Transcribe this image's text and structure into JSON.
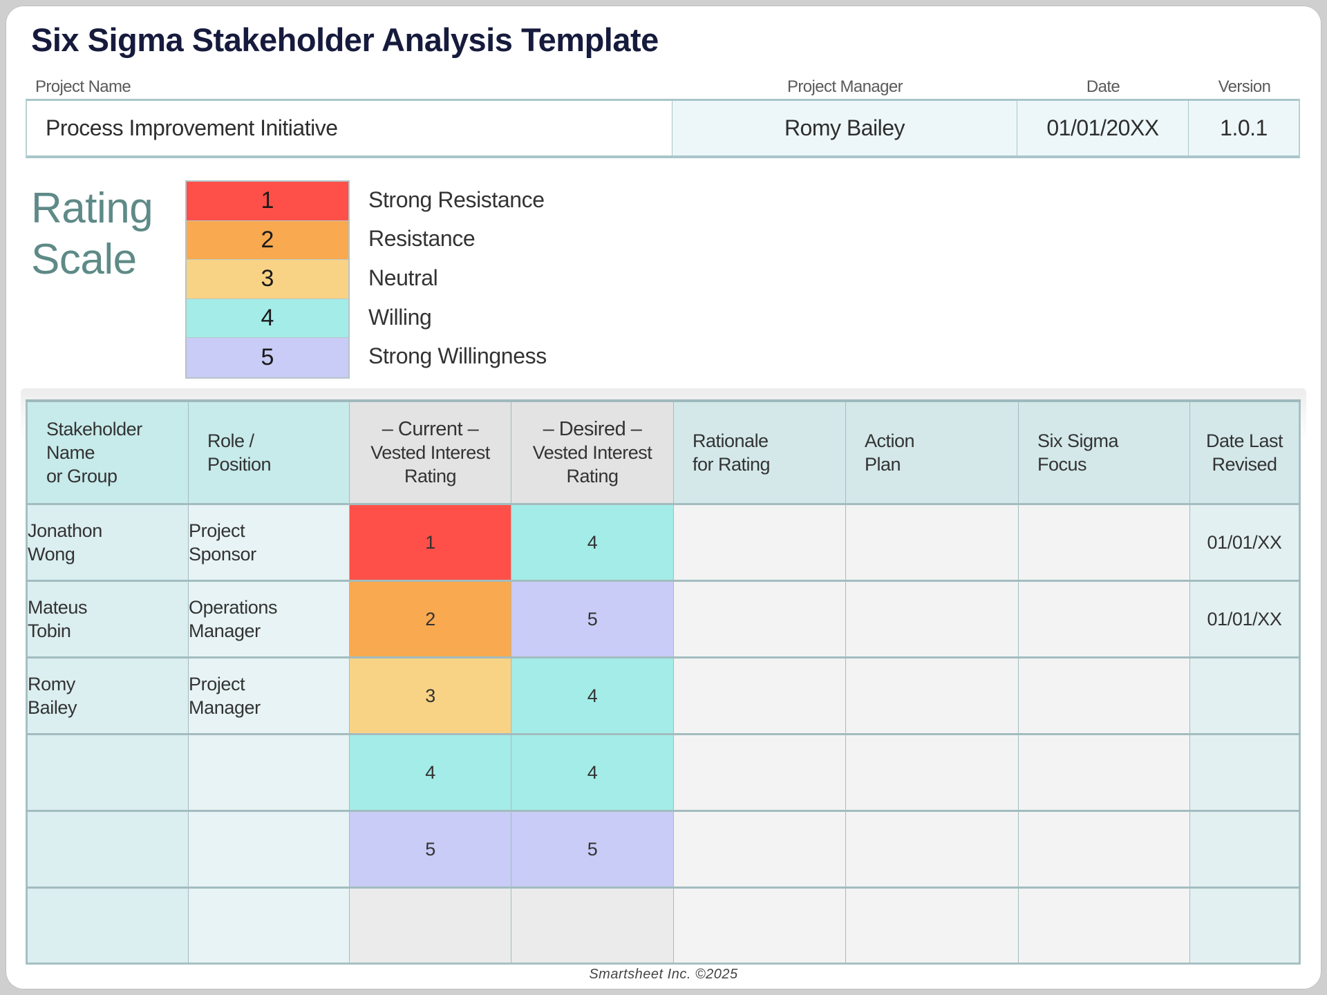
{
  "title": "Six Sigma Stakeholder Analysis Template",
  "project_info": {
    "labels": {
      "project_name": "Project Name",
      "project_manager": "Project Manager",
      "date": "Date",
      "version": "Version"
    },
    "values": {
      "project_name": "Process Improvement Initiative",
      "project_manager": "Romy Bailey",
      "date": "01/01/20XX",
      "version": "1.0.1"
    }
  },
  "rating_scale": {
    "title_line1": "Rating",
    "title_line2": "Scale",
    "levels": [
      {
        "value": "1",
        "label": "Strong Resistance",
        "color": "#fe5048"
      },
      {
        "value": "2",
        "label": "Resistance",
        "color": "#f9a94f"
      },
      {
        "value": "3",
        "label": "Neutral",
        "color": "#f9d385"
      },
      {
        "value": "4",
        "label": "Willing",
        "color": "#a4ece8"
      },
      {
        "value": "5",
        "label": "Strong Willingness",
        "color": "#c8ccf6"
      }
    ]
  },
  "table": {
    "headers": {
      "name": [
        "Stakeholder",
        "Name",
        "or Group"
      ],
      "role": [
        "Role /",
        "Position"
      ],
      "current": [
        "– Current –",
        "Vested Interest",
        "Rating"
      ],
      "desired": [
        "– Desired –",
        "Vested Interest",
        "Rating"
      ],
      "rationale": [
        "Rationale",
        "for Rating"
      ],
      "action": [
        "Action",
        "Plan"
      ],
      "focus": [
        "Six Sigma",
        "Focus"
      ],
      "date": [
        "Date Last",
        "Revised"
      ]
    },
    "rows": [
      {
        "name": [
          "Jonathon",
          "Wong"
        ],
        "role": [
          "Project",
          "Sponsor"
        ],
        "current": "1",
        "desired": "4",
        "rationale": "",
        "action": "",
        "focus": "",
        "date": "01/01/XX"
      },
      {
        "name": [
          "Mateus",
          "Tobin"
        ],
        "role": [
          "Operations",
          "Manager"
        ],
        "current": "2",
        "desired": "5",
        "rationale": "",
        "action": "",
        "focus": "",
        "date": "01/01/XX"
      },
      {
        "name": [
          "Romy",
          "Bailey"
        ],
        "role": [
          "Project",
          "Manager"
        ],
        "current": "3",
        "desired": "4",
        "rationale": "",
        "action": "",
        "focus": "",
        "date": ""
      },
      {
        "name": [
          "",
          ""
        ],
        "role": [
          "",
          ""
        ],
        "current": "4",
        "desired": "4",
        "rationale": "",
        "action": "",
        "focus": "",
        "date": ""
      },
      {
        "name": [
          "",
          ""
        ],
        "role": [
          "",
          ""
        ],
        "current": "5",
        "desired": "5",
        "rationale": "",
        "action": "",
        "focus": "",
        "date": ""
      },
      {
        "name": [
          "",
          ""
        ],
        "role": [
          "",
          ""
        ],
        "current": "",
        "desired": "",
        "rationale": "",
        "action": "",
        "focus": "",
        "date": ""
      }
    ]
  },
  "footer": "Smartsheet Inc. ©2025"
}
